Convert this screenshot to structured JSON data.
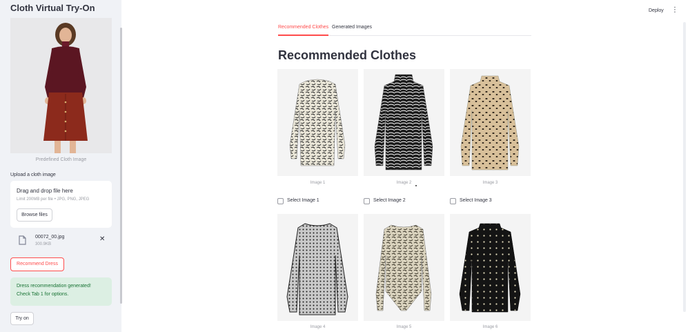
{
  "sidebar": {
    "app_title": "Cloth Virtual Try-On",
    "image_caption": "Predefined Cloth Image",
    "upload_label": "Upload a cloth image",
    "dropzone": {
      "title": "Drag and drop file here",
      "limit": "Limit 200MB per file • JPG, PNG, JPEG",
      "browse_label": "Browse files"
    },
    "file": {
      "name": "00072_00.jpg",
      "size": "300.9KB"
    },
    "recommend_label": "Recommend Dress",
    "success_line1": "Dress recommendation generated!",
    "success_line2": "Check Tab 1 for options.",
    "tryon_label": "Try on"
  },
  "header": {
    "deploy_label": "Deploy",
    "menu_icon": "⋮"
  },
  "tabs": [
    {
      "label": "Recommended Clothes",
      "active": true
    },
    {
      "label": "Generated Images",
      "active": false
    }
  ],
  "section_title": "Recommended Clothes",
  "items": [
    {
      "caption": "Image 1",
      "checkbox": "Select Image 1",
      "pattern": "paisley"
    },
    {
      "caption": "Image 2",
      "checkbox": "Select Image 2",
      "pattern": "zebra"
    },
    {
      "caption": "Image 3",
      "checkbox": "Select Image 3",
      "pattern": "leopard"
    },
    {
      "caption": "Image 4",
      "checkbox": "",
      "pattern": "mesh"
    },
    {
      "caption": "Image 5",
      "checkbox": "",
      "pattern": "paisley-bodysuit"
    },
    {
      "caption": "Image 6",
      "checkbox": "",
      "pattern": "polka"
    }
  ],
  "colors": {
    "accent": "#ff4b4b",
    "sidebar_bg": "#f0f2f6",
    "success_bg": "#dcefe3",
    "success_text": "#177233"
  }
}
